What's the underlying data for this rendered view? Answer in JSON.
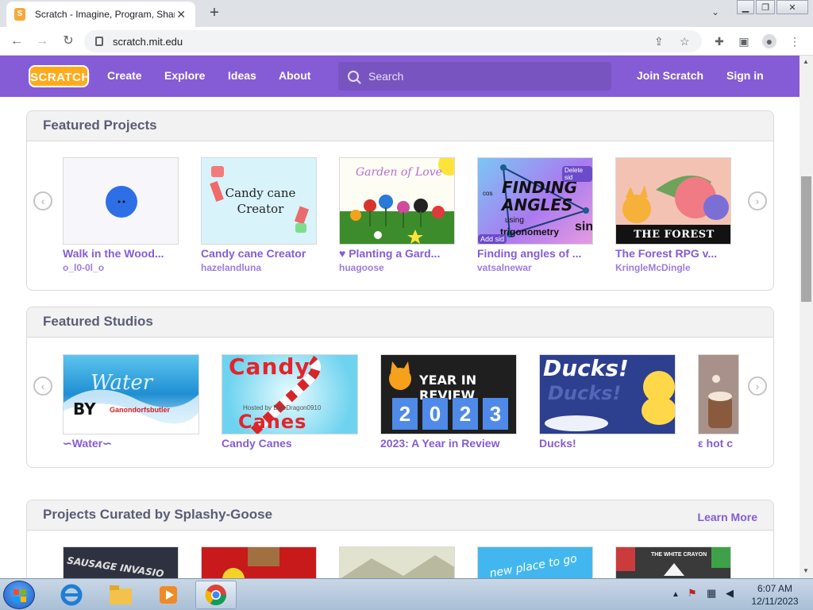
{
  "browser": {
    "tab_title": "Scratch - Imagine, Program, Share",
    "tab_close": "✕",
    "new_tab": "+",
    "url": "scratch.mit.edu",
    "back": "←",
    "forward": "→",
    "reload": "↻"
  },
  "nav": {
    "logo": "SCRATCH",
    "links": [
      "Create",
      "Explore",
      "Ideas",
      "About"
    ],
    "search_placeholder": "Search",
    "join": "Join Scratch",
    "signin": "Sign in"
  },
  "featured_projects": {
    "heading": "Featured Projects",
    "items": [
      {
        "title": "Walk in the Wood...",
        "author": "o_l0-0l_o"
      },
      {
        "title": "Candy cane Creator",
        "author": "hazelandluna"
      },
      {
        "title": "♥ Planting a Gard...",
        "author": "huagoose"
      },
      {
        "title": "Finding angles of ...",
        "author": "vatsalnewar"
      },
      {
        "title": "The Forest RPG v...",
        "author": "KringleMcDingle"
      }
    ],
    "thumb_text": {
      "candy": "Candy cane\nCreator",
      "garden": "Garden of Love",
      "angles_1": "FINDING",
      "angles_2": "ANGLES",
      "angles_3": "using",
      "angles_4": "trigonometry",
      "angles_sin": "sin",
      "angles_cos": "cos",
      "angles_tag": "Delete sid",
      "angles_tag2": "Add sid",
      "forest": "THE FOREST"
    }
  },
  "featured_studios": {
    "heading": "Featured Studios",
    "items": [
      {
        "title": "∽Water∽"
      },
      {
        "title": "Candy Canes"
      },
      {
        "title": "2023: A Year in Review"
      },
      {
        "title": "Ducks!"
      },
      {
        "title": "ε hot c"
      }
    ],
    "thumb_text": {
      "water": "Water",
      "water_by": "BY",
      "water_credit": "Ganondorfsbutler",
      "candy_top": "Candy",
      "candy_bottom": "Canes",
      "candy_credit": "Hosted by BlueDragon0910",
      "year": "YEAR IN REVIEW",
      "digits": [
        "2",
        "0",
        "2",
        "3"
      ],
      "ducks": "Ducks!",
      "ducks2": "Ducks!"
    }
  },
  "curated": {
    "heading": "Projects Curated by Splashy-Goose",
    "learn_more": "Learn More",
    "thumb_text": {
      "sausage": "SAUSAGE INVASIO",
      "place": "new place to go",
      "crayon": "THE WHITE CRAYON"
    }
  },
  "taskbar": {
    "time": "6:07 AM",
    "date": "12/11/2023"
  },
  "colors": {
    "scratch_purple": "#855cd6",
    "scratch_orange": "#ffab19"
  }
}
